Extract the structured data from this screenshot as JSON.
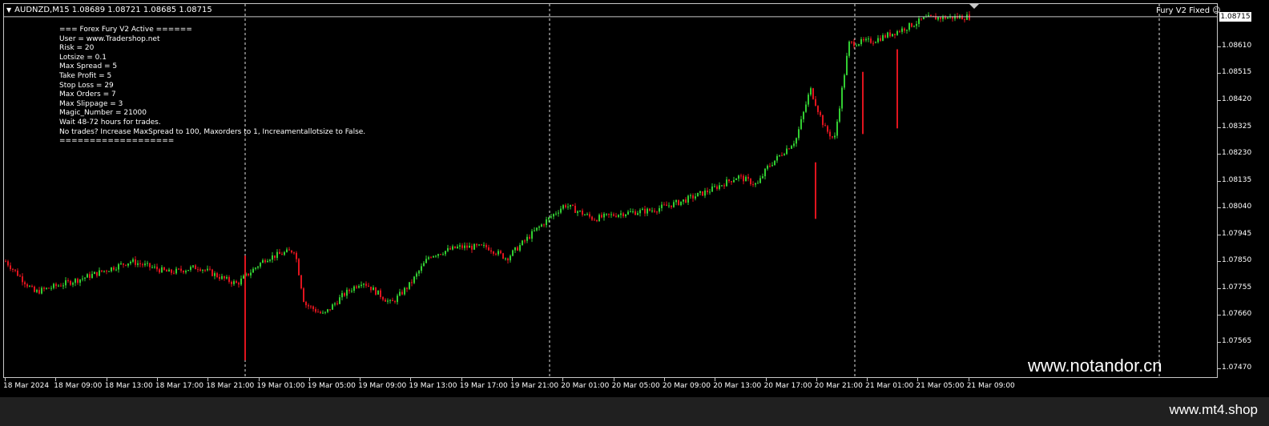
{
  "chart": {
    "symbol_line": "AUDNZD,M15  1.08689 1.08721 1.08685 1.08715",
    "indicator_name": "Fury V2 Fixed",
    "smiley_icon": "smiley-face-icon",
    "bid_price": "1.08715",
    "colors": {
      "background": "#000000",
      "bull": "#32CD32",
      "bear": "#E0141E",
      "grid": "#C8C8C8"
    }
  },
  "info_panel": {
    "lines": [
      "=== Forex Fury V2 Active ======",
      "User = www.Tradershop.net",
      "Risk = 20",
      "Lotsize = 0.1",
      "Max Spread = 5",
      "Take Profit = 5",
      "Stop Loss = 29",
      "Max Orders = 7",
      "Max Slippage = 3",
      "Magic_Number = 21000",
      "Wait 48-72 hours for trades.",
      "No trades? Increase MaxSpread to 100, Maxorders to 1, Increamentallotsize to False.",
      "==================="
    ]
  },
  "price_scale": [
    "1.08610",
    "1.08515",
    "1.08420",
    "1.08325",
    "1.08230",
    "1.08135",
    "1.08040",
    "1.07945",
    "1.07850",
    "1.07755",
    "1.07660",
    "1.07565",
    "1.07470"
  ],
  "time_axis": [
    "18 Mar 2024",
    "18 Mar 09:00",
    "18 Mar 13:00",
    "18 Mar 17:00",
    "18 Mar 21:00",
    "19 Mar 01:00",
    "19 Mar 05:00",
    "19 Mar 09:00",
    "19 Mar 13:00",
    "19 Mar 17:00",
    "19 Mar 21:00",
    "20 Mar 01:00",
    "20 Mar 05:00",
    "20 Mar 09:00",
    "20 Mar 13:00",
    "20 Mar 17:00",
    "20 Mar 21:00",
    "21 Mar 01:00",
    "21 Mar 05:00",
    "21 Mar 09:00"
  ],
  "watermark": "www.notandor.cn",
  "footer": "www.mt4.shop",
  "chart_data": {
    "type": "candlestick",
    "symbol": "AUDNZD",
    "timeframe": "M15",
    "ylim": [
      1.0744,
      1.0876
    ],
    "trend_anchors": [
      {
        "t": 0.0,
        "p": 1.0785
      },
      {
        "t": 0.03,
        "p": 1.0774
      },
      {
        "t": 0.08,
        "p": 1.0779
      },
      {
        "t": 0.13,
        "p": 1.0785
      },
      {
        "t": 0.17,
        "p": 1.0781
      },
      {
        "t": 0.2,
        "p": 1.0783
      },
      {
        "t": 0.225,
        "p": 1.0779
      },
      {
        "t": 0.24,
        "p": 1.0777
      },
      {
        "t": 0.27,
        "p": 1.0786
      },
      {
        "t": 0.3,
        "p": 1.0789
      },
      {
        "t": 0.31,
        "p": 1.077
      },
      {
        "t": 0.33,
        "p": 1.0766
      },
      {
        "t": 0.35,
        "p": 1.0773
      },
      {
        "t": 0.37,
        "p": 1.0778
      },
      {
        "t": 0.4,
        "p": 1.077
      },
      {
        "t": 0.42,
        "p": 1.0777
      },
      {
        "t": 0.44,
        "p": 1.0787
      },
      {
        "t": 0.47,
        "p": 1.079
      },
      {
        "t": 0.5,
        "p": 1.079
      },
      {
        "t": 0.52,
        "p": 1.0786
      },
      {
        "t": 0.55,
        "p": 1.0796
      },
      {
        "t": 0.58,
        "p": 1.0805
      },
      {
        "t": 0.61,
        "p": 1.08
      },
      {
        "t": 0.64,
        "p": 1.0802
      },
      {
        "t": 0.67,
        "p": 1.0803
      },
      {
        "t": 0.7,
        "p": 1.0806
      },
      {
        "t": 0.73,
        "p": 1.081
      },
      {
        "t": 0.76,
        "p": 1.0815
      },
      {
        "t": 0.78,
        "p": 1.0812
      },
      {
        "t": 0.79,
        "p": 1.0818
      },
      {
        "t": 0.82,
        "p": 1.0828
      },
      {
        "t": 0.835,
        "p": 1.0846
      },
      {
        "t": 0.85,
        "p": 1.0832
      },
      {
        "t": 0.86,
        "p": 1.0828
      },
      {
        "t": 0.875,
        "p": 1.0862
      },
      {
        "t": 0.9,
        "p": 1.0863
      },
      {
        "t": 0.93,
        "p": 1.0867
      },
      {
        "t": 0.955,
        "p": 1.0871
      },
      {
        "t": 1.0,
        "p": 1.08715
      }
    ]
  }
}
